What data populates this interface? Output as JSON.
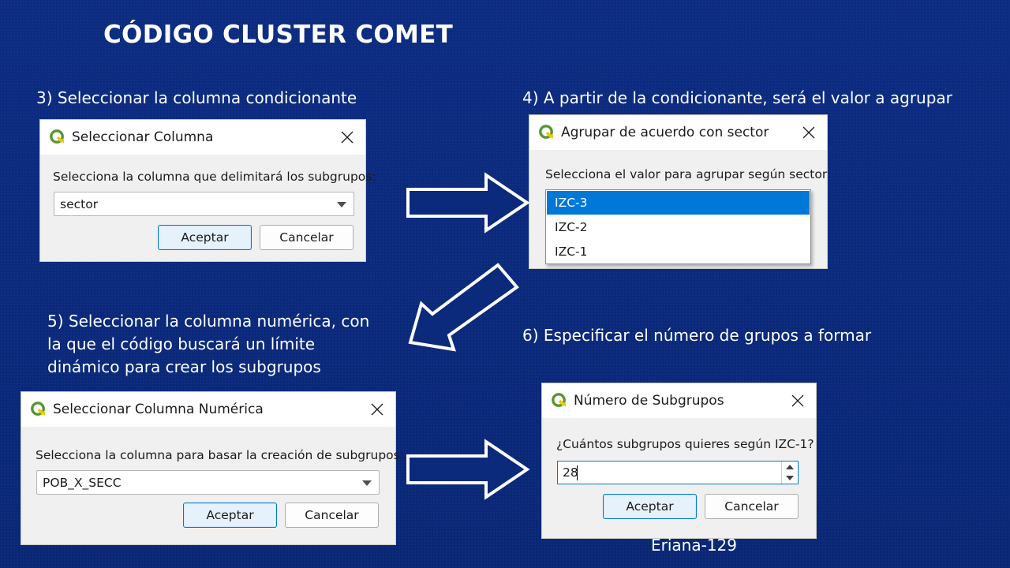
{
  "slide": {
    "title": "CÓDIGO CLUSTER COMET",
    "footer": "Eriana-129"
  },
  "steps": {
    "step3": "3) Seleccionar la columna condicionante",
    "step4": "4) A partir de la condicionante, será el valor a agrupar",
    "step5_line1": "5) Seleccionar la columna numérica, con",
    "step5_line2": "la que el código buscará un límite",
    "step5_line3": "dinámico para crear los subgrupos",
    "step6": "6) Especificar el número de grupos a formar"
  },
  "dialog_select_column": {
    "title": "Seleccionar Columna",
    "prompt": "Selecciona la columna que delimitará los subgrupos:",
    "combo_value": "sector",
    "accept_label": "Aceptar",
    "cancel_label": "Cancelar"
  },
  "dialog_group_by": {
    "title": "Agrupar de acuerdo con sector",
    "prompt": "Selecciona el valor para agrupar según sector:",
    "options": [
      "IZC-3",
      "IZC-2",
      "IZC-1"
    ],
    "selected_option": "IZC-3"
  },
  "dialog_numeric_column": {
    "title": "Seleccionar Columna Numérica",
    "prompt": "Selecciona la columna para basar la creación de subgrupos:",
    "combo_value": "POB_X_SECC",
    "accept_label": "Aceptar",
    "cancel_label": "Cancelar"
  },
  "dialog_num_subgroups": {
    "title": "Número de Subgrupos",
    "prompt": "¿Cuántos subgrupos quieres según IZC-1?",
    "spin_value": "28",
    "accept_label": "Aceptar",
    "cancel_label": "Cancelar"
  },
  "colors": {
    "background": "#0b2a7c",
    "selection": "#0078d7",
    "qgis_green": "#589632",
    "qgis_yellow": "#eec900"
  },
  "icons": {
    "app_icon": "qgis-logo-icon",
    "close": "close-icon",
    "flow_arrow": "outline-arrow-icon"
  }
}
